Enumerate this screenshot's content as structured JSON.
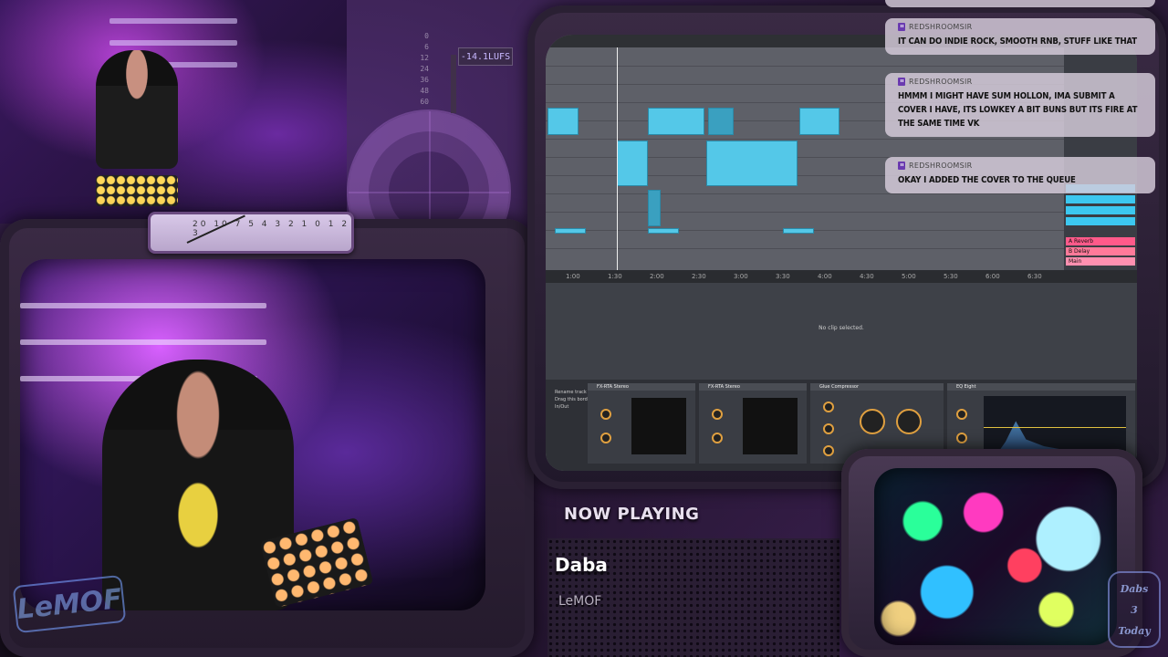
{
  "stream": {
    "lufs_readout": "-14.1LUFS",
    "meter_ticks": [
      "0",
      "6",
      "12",
      "24",
      "36",
      "48",
      "60"
    ],
    "vu_scale": "20 10 7 5 4 3 2 1 0 1 2 3",
    "logo_left": "LeMOF",
    "logo_right_top": "Dabs",
    "logo_right_num": "3",
    "logo_right_bottom": "Today"
  },
  "chat": {
    "messages": [
      {
        "user": "REDSHROOMSIR",
        "text": "IT CAN DO INDIE ROCK, SMOOTH RNB, STUFF LIKE THAT"
      },
      {
        "user": "REDSHROOMSIR",
        "text": "HMMM I MIGHT HAVE SUM HOLLON, IMA SUBMIT A COVER I HAVE, ITS LOWKEY A BIT BUNS BUT ITS FIRE AT THE SAME TIME VK"
      },
      {
        "user": "REDSHROOMSIR",
        "text": "OKAY I ADDED THE COVER TO THE QUEUE"
      }
    ]
  },
  "now_playing": {
    "label": "NOW PLAYING",
    "title": "Daba",
    "artist": "LeMOF"
  },
  "daw": {
    "timeline": [
      "1:00",
      "1:30",
      "2:00",
      "2:30",
      "3:00",
      "3:30",
      "4:00",
      "4:30",
      "5:00",
      "5:30",
      "6:00",
      "6:30"
    ],
    "detail_message": "No clip selected.",
    "mixer_tracks": [
      "A Reverb",
      "B Delay",
      "Main"
    ],
    "mixer_colors": [
      "#ff5a8a",
      "#ff7a9a",
      "#ff90b0"
    ],
    "devices": [
      "FX-RTA Stereo",
      "FX-RTA Stereo",
      "Glue Compressor",
      "EQ Eight"
    ],
    "device_side_labels": [
      "Rename track",
      "Drag this border",
      "In/Out"
    ]
  },
  "colors": {
    "clip": "#54c8e8",
    "accent": "#b070e0"
  }
}
